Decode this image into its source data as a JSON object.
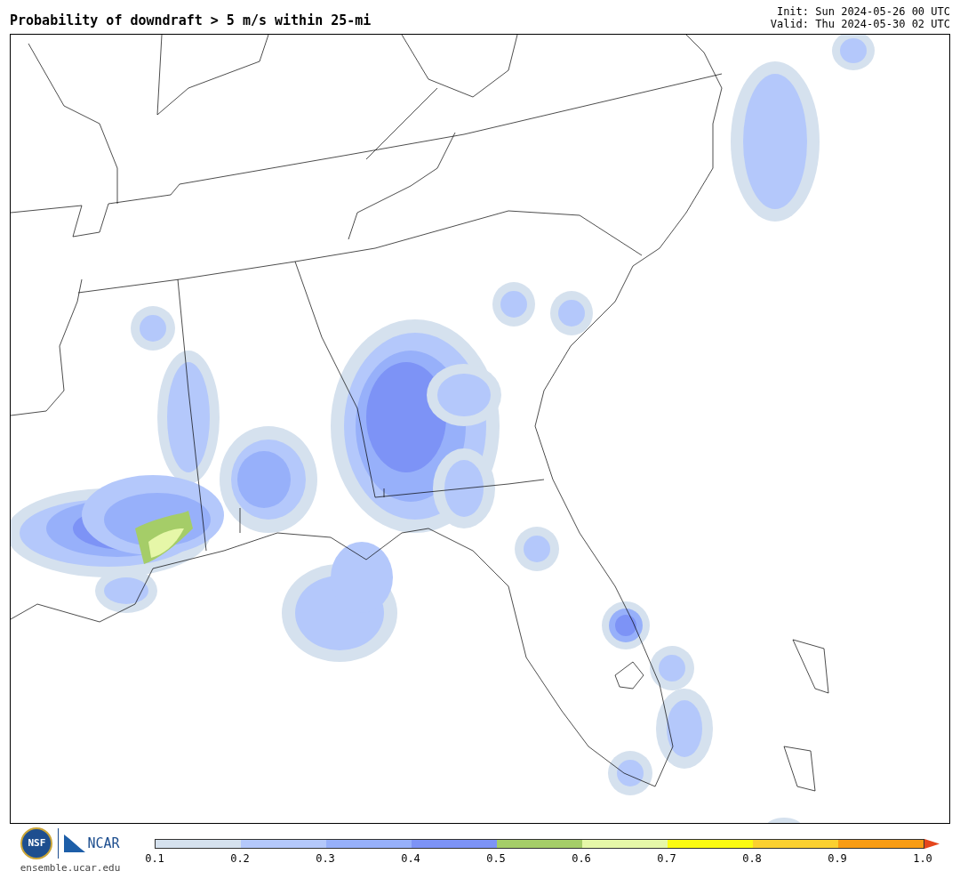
{
  "header": {
    "title": "Probability of downdraft > 5 m/s within 25-mi",
    "init": "Init: Sun 2024-05-26 00 UTC",
    "valid": "Valid: Thu 2024-05-30 02 UTC"
  },
  "footer": {
    "nsf_logo": "NSF",
    "ncar_logo": "NCAR",
    "url": "ensemble.ucar.edu",
    "colorbar": {
      "bins": [
        {
          "kind": "bin",
          "color": "#d5e1ee"
        },
        {
          "kind": "bin",
          "color": "#b4c8fb"
        },
        {
          "kind": "bin",
          "color": "#97b0fa"
        },
        {
          "kind": "bin",
          "color": "#7d93f6"
        },
        {
          "kind": "bin",
          "color": "#a5cd68"
        },
        {
          "kind": "bin",
          "color": "#e6f7a8"
        },
        {
          "kind": "bin",
          "color": "#fbfb12"
        },
        {
          "kind": "bin",
          "color": "#fbd030"
        },
        {
          "kind": "bin",
          "color": "#f89c14"
        },
        {
          "kind": "arrow",
          "color": "#e5461c"
        }
      ],
      "ticks": [
        "0.1",
        "0.2",
        "0.3",
        "0.4",
        "0.5",
        "0.6",
        "0.7",
        "0.8",
        "0.9",
        "1.0"
      ]
    }
  }
}
